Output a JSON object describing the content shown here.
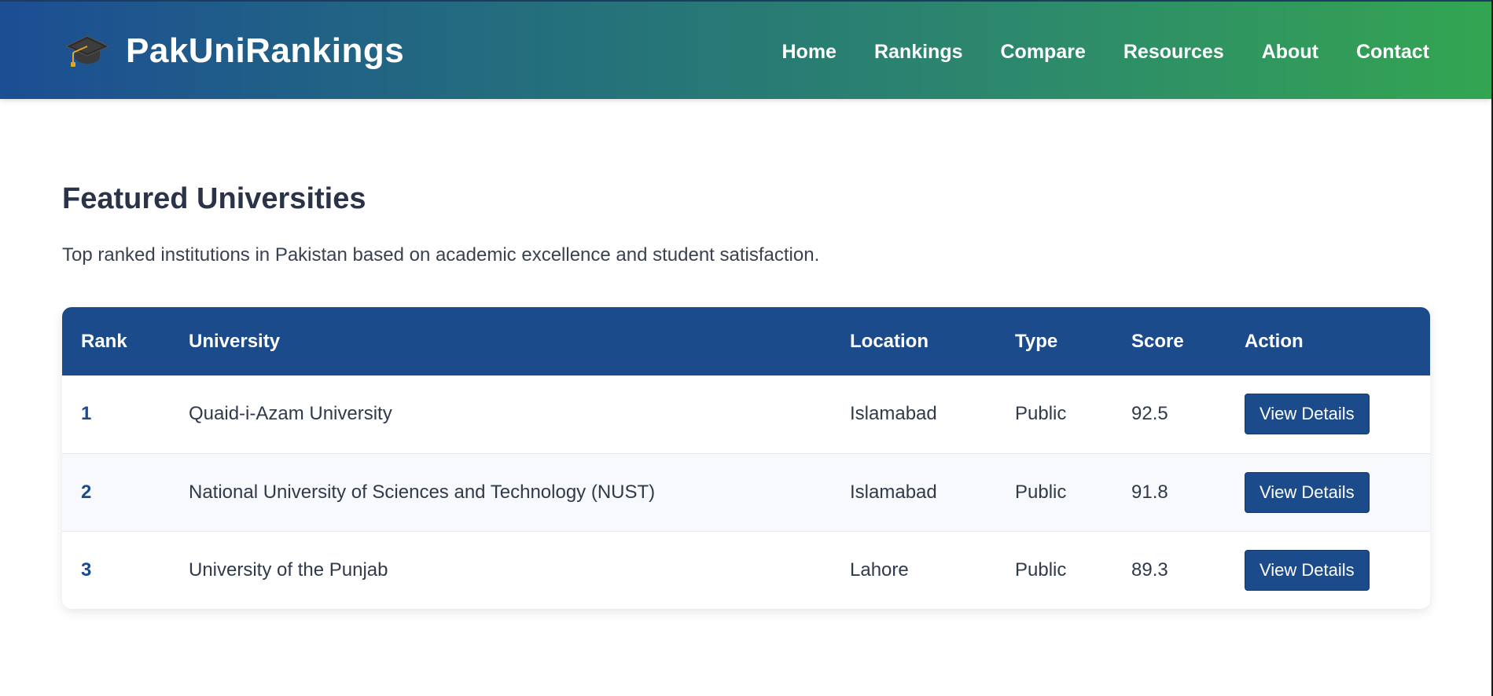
{
  "brand": {
    "name": "PakUniRankings",
    "icon": "graduation-cap-icon"
  },
  "nav": {
    "items": [
      "Home",
      "Rankings",
      "Compare",
      "Resources",
      "About",
      "Contact"
    ]
  },
  "featured": {
    "title": "Featured Universities",
    "description": "Top ranked institutions in Pakistan based on academic excellence and student satisfaction."
  },
  "table": {
    "headers": {
      "rank": "Rank",
      "university": "University",
      "location": "Location",
      "type": "Type",
      "score": "Score",
      "action": "Action"
    },
    "rows": [
      {
        "rank": "1",
        "university": "Quaid-i-Azam University",
        "location": "Islamabad",
        "type": "Public",
        "score": "92.5",
        "action": "View Details"
      },
      {
        "rank": "2",
        "university": "National University of Sciences and Technology (NUST)",
        "location": "Islamabad",
        "type": "Public",
        "score": "91.8",
        "action": "View Details"
      },
      {
        "rank": "3",
        "university": "University of the Punjab",
        "location": "Lahore",
        "type": "Public",
        "score": "89.3",
        "action": "View Details"
      }
    ]
  },
  "colors": {
    "primary": "#1c4b8c",
    "header_gradient_start": "#1c4e93",
    "header_gradient_end": "#33a551"
  }
}
